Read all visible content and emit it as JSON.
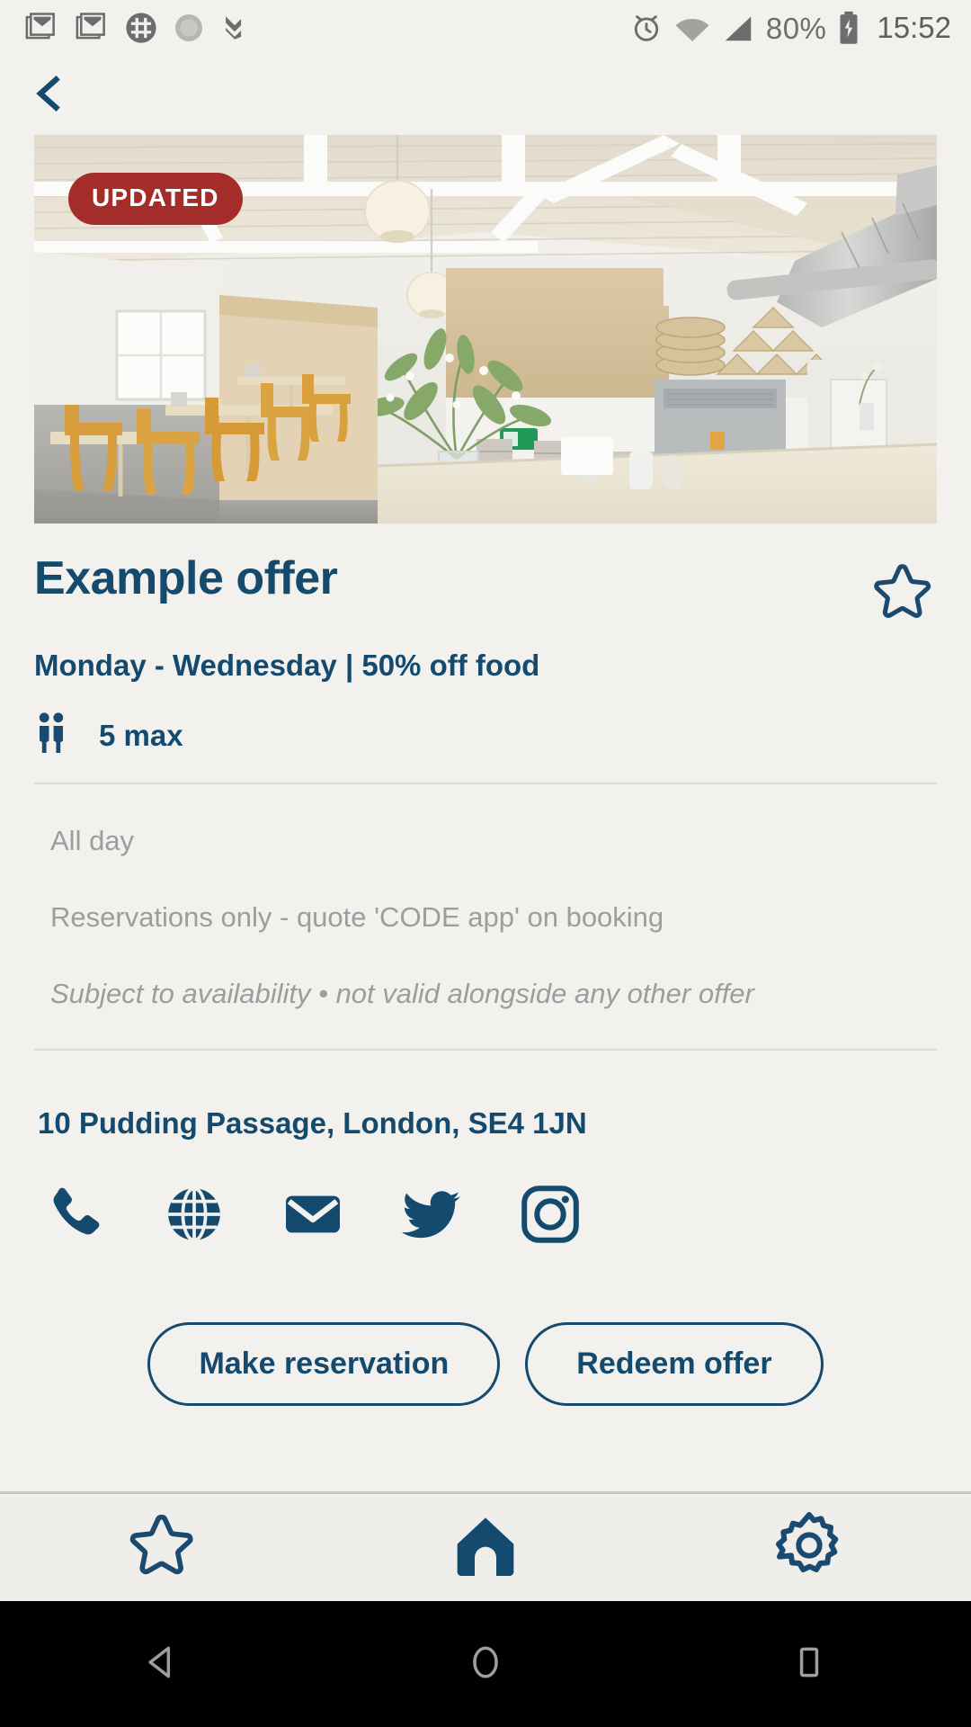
{
  "statusbar": {
    "icons_left": [
      "gmail-icon",
      "gmail-icon",
      "slack-icon",
      "circle-icon",
      "todoist-icon"
    ],
    "icons_right": [
      "alarm-icon",
      "wifi-icon",
      "signal-icon"
    ],
    "battery_level": "80%",
    "battery_icon": "battery-charging-icon",
    "time": "15:52"
  },
  "navigation": {
    "back_label": "Back",
    "back_icon": "chevron-left-icon"
  },
  "offer": {
    "badge": "UPDATED",
    "title": "Example offer",
    "subtitle": "Monday - Wednesday | 50% off food",
    "capacity": "5 max",
    "capacity_icon": "people-icon",
    "favourite_icon": "star-outline-icon",
    "terms": [
      "All day",
      "Reservations only - quote 'CODE app' on booking",
      "Subject to availability • not valid alongside any other offer"
    ]
  },
  "venue": {
    "address": "10 Pudding Passage, London, SE4 1JN",
    "contacts": [
      {
        "name": "phone-icon",
        "label": "Call venue"
      },
      {
        "name": "globe-icon",
        "label": "Visit website"
      },
      {
        "name": "email-icon",
        "label": "Email venue"
      },
      {
        "name": "twitter-icon",
        "label": "Twitter"
      },
      {
        "name": "instagram-icon",
        "label": "Instagram"
      }
    ]
  },
  "actions": {
    "reservation_label": "Make reservation",
    "redeem_label": "Redeem offer"
  },
  "tabbar": {
    "items": [
      {
        "name": "tab-favourites",
        "icon": "star-outline-icon",
        "active": false
      },
      {
        "name": "tab-home",
        "icon": "home-filled-icon",
        "active": true
      },
      {
        "name": "tab-settings",
        "icon": "gear-outline-icon",
        "active": false
      }
    ]
  },
  "android_nav": {
    "back": "back-triangle-icon",
    "home": "home-circle-icon",
    "recents": "recents-square-icon"
  },
  "colors": {
    "brand_navy": "#134a6e",
    "badge_red": "#a52d29",
    "page_bg": "#f2f1ee",
    "muted_text": "#9d9d9d"
  }
}
